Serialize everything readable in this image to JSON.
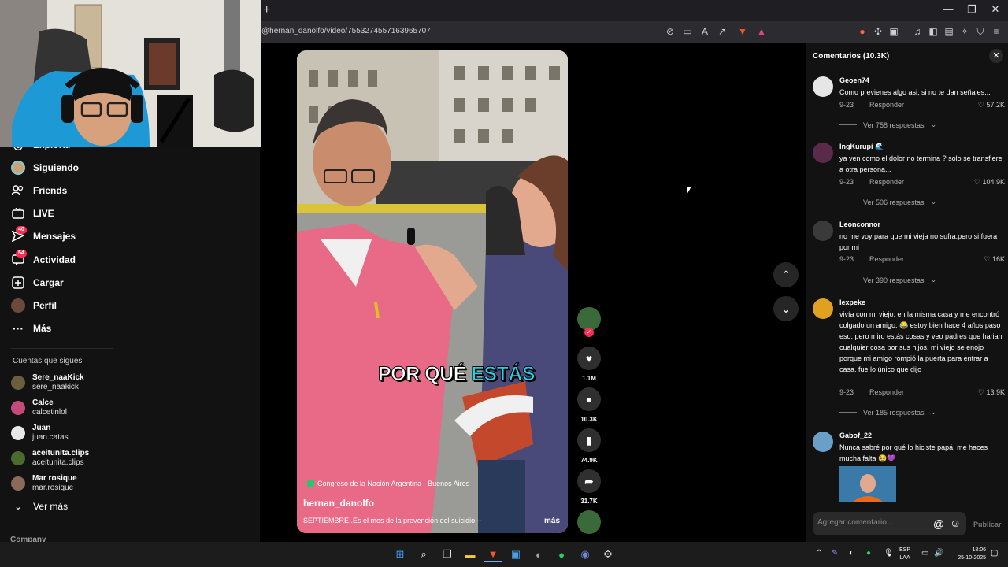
{
  "browser": {
    "url": "@hernan_danolfo/video/7553274557163965707",
    "new_tab": "+",
    "win_min": "—",
    "win_max": "❐",
    "win_close": "✕"
  },
  "sidebar": {
    "items": [
      {
        "label": "Explorar",
        "icon": "compass-icon",
        "glyph": "◎"
      },
      {
        "label": "Siguiendo",
        "icon": "following-avatar-icon",
        "glyph": "◉"
      },
      {
        "label": "Friends",
        "icon": "friends-icon",
        "glyph": "👥"
      },
      {
        "label": "LIVE",
        "icon": "live-icon",
        "glyph": "▣"
      },
      {
        "label": "Mensajes",
        "icon": "messages-icon",
        "glyph": "✉",
        "badge": "40"
      },
      {
        "label": "Actividad",
        "icon": "activity-icon",
        "glyph": "▢",
        "badge": "54"
      },
      {
        "label": "Cargar",
        "icon": "upload-icon",
        "glyph": "⊞"
      },
      {
        "label": "Perfil",
        "icon": "profile-icon",
        "glyph": "●"
      },
      {
        "label": "Más",
        "icon": "more-icon",
        "glyph": "···"
      }
    ],
    "following_header": "Cuentas que sigues",
    "accounts": [
      {
        "name": "Sere_naaKick",
        "handle": "sere_naakick",
        "color": "#6b5e3c"
      },
      {
        "name": "Calce",
        "handle": "calcetinlol",
        "color": "#c44a7a"
      },
      {
        "name": "Juan",
        "handle": "juan.catas",
        "color": "#e8e8e8"
      },
      {
        "name": "aceitunita.clips",
        "handle": "aceitunita.clips",
        "color": "#4a6b2e"
      },
      {
        "name": "Mar rosique",
        "handle": "mar.rosique",
        "color": "#8c6a5a"
      }
    ],
    "see_more": "Ver más",
    "company": "Company"
  },
  "video": {
    "caption_a": "POR QUÉ ",
    "caption_b": "ESTÁS",
    "location": "Congreso de la Nación Argentina · Buenos Aires",
    "author": "hernan_danolfo",
    "description": "SEPTIEMBRE..Es el mes de la prevención del suicidio!--",
    "more": "más",
    "likes": "1.1M",
    "comments": "10.3K",
    "saves": "74.9K",
    "shares": "31.7K"
  },
  "comments_panel": {
    "title": "Comentarios (10.3K)",
    "close": "✕",
    "reply_label": "Responder",
    "items": [
      {
        "user": "Geoen74",
        "text": "Como previenes algo asi, si no te dan señales...",
        "date": "9-23",
        "likes": "57.2K",
        "replies": "Ver 758 respuestas",
        "color": "#e6e6e6"
      },
      {
        "user": "IngKurupí 🌊",
        "text": "ya ven como el dolor no termina ? solo se transfiere a otra persona...",
        "date": "9-23",
        "likes": "104.9K",
        "replies": "Ver 506 respuestas",
        "color": "#5a2a4a"
      },
      {
        "user": "Leonconnor",
        "text": "no me voy para que mi vieja no sufra.pero si fuera por mi",
        "date": "9-23",
        "likes": "16K",
        "replies": "Ver 390 respuestas",
        "color": "#3a3a3a"
      },
      {
        "user": "lexpeke",
        "text": "vivía con mi viejo. en la misma casa y me encontró colgado un amigo. 😂 estoy bien hace 4 años paso eso. pero miro estás cosas y veo padres que harian cualquier cosa por sus hijos. mi viejo se enojo porque mi amigo rompió la puerta para entrar a casa. fue lo único que dijo",
        "date": "9-23",
        "likes": "13.9K",
        "replies": "Ver 185 respuestas",
        "color": "#e0a020"
      },
      {
        "user": "Gabof_22",
        "text": "Nunca sabré por qué lo hiciste papá, me haces mucha falta 🥹💜",
        "date": "",
        "likes": "",
        "replies": "",
        "color": "#6aa0c8"
      }
    ],
    "add_placeholder": "Agregar comentario...",
    "publish": "Publicar"
  },
  "taskbar": {
    "lang_a": "ESP",
    "lang_b": "LAA",
    "time": "18:06",
    "date": "25-10-2025"
  }
}
